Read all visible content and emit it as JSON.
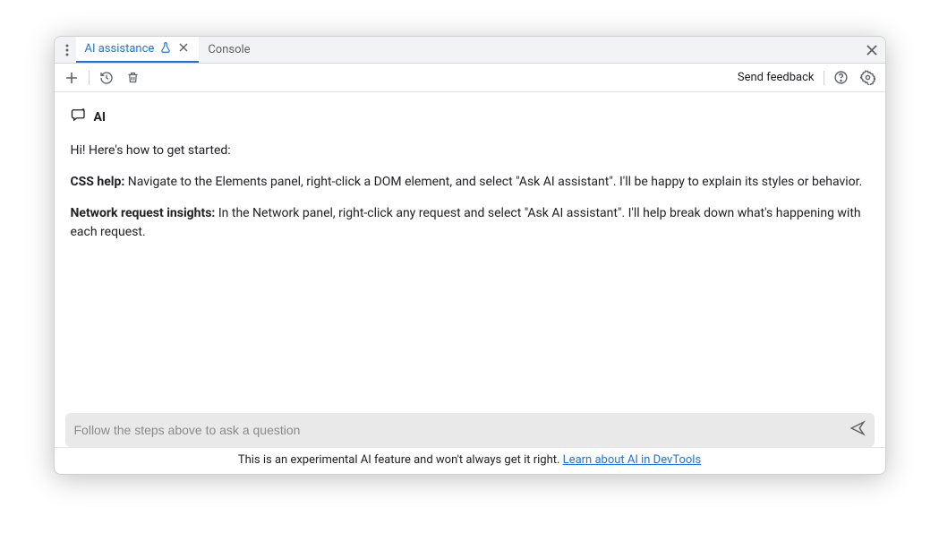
{
  "tabs": {
    "ai_assistance": "AI assistance",
    "console": "Console"
  },
  "toolbar": {
    "send_feedback": "Send feedback"
  },
  "content": {
    "ai_label": "AI",
    "greeting": "Hi! Here's how to get started:",
    "css_help_label": "CSS help:",
    "css_help_text": " Navigate to the Elements panel, right-click a DOM element, and select \"Ask AI assistant\". I'll be happy to explain its styles or behavior.",
    "network_label": "Network request insights:",
    "network_text": " In the Network panel, right-click any request and select \"Ask AI assistant\". I'll help break down what's happening with each request."
  },
  "input": {
    "placeholder": "Follow the steps above to ask a question"
  },
  "footer": {
    "text": "This is an experimental AI feature and won't always get it right. ",
    "link": "Learn about AI in DevTools"
  }
}
